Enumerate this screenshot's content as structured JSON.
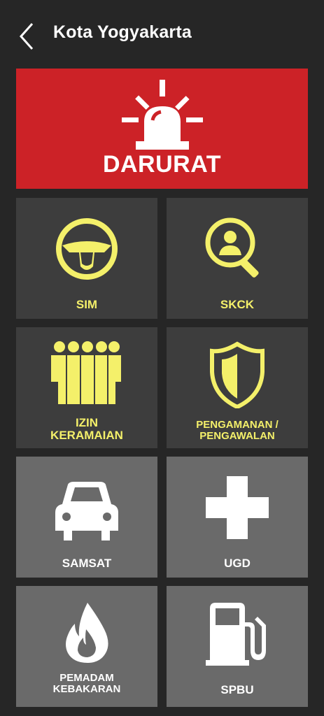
{
  "header": {
    "title": "Kota Yogyakarta",
    "back_icon": "chevron-left-icon"
  },
  "emergency": {
    "label": "DARURAT",
    "icon": "siren-icon",
    "color": "#cc2227"
  },
  "tiles": [
    {
      "label": "SIM",
      "icon": "steering-wheel-icon"
    },
    {
      "label": "SKCK",
      "icon": "person-search-icon"
    },
    {
      "label_line1": "IZIN",
      "label_line2": "KERAMAIAN",
      "icon": "crowd-icon"
    },
    {
      "label_line1": "PENGAMANAN /",
      "label_line2": "PENGAWALAN",
      "icon": "shield-icon"
    },
    {
      "label": "SAMSAT",
      "icon": "car-icon"
    },
    {
      "label": "UGD",
      "icon": "medical-cross-icon"
    },
    {
      "label_line1": "PEMADAM",
      "label_line2": "KEBAKARAN",
      "icon": "flame-icon"
    },
    {
      "label": "SPBU",
      "icon": "fuel-pump-icon"
    }
  ],
  "colors": {
    "background": "#262626",
    "tile_dark": "#3d3d3d",
    "tile_light": "#6a6a6a",
    "accent_yellow": "#f4f06a"
  }
}
